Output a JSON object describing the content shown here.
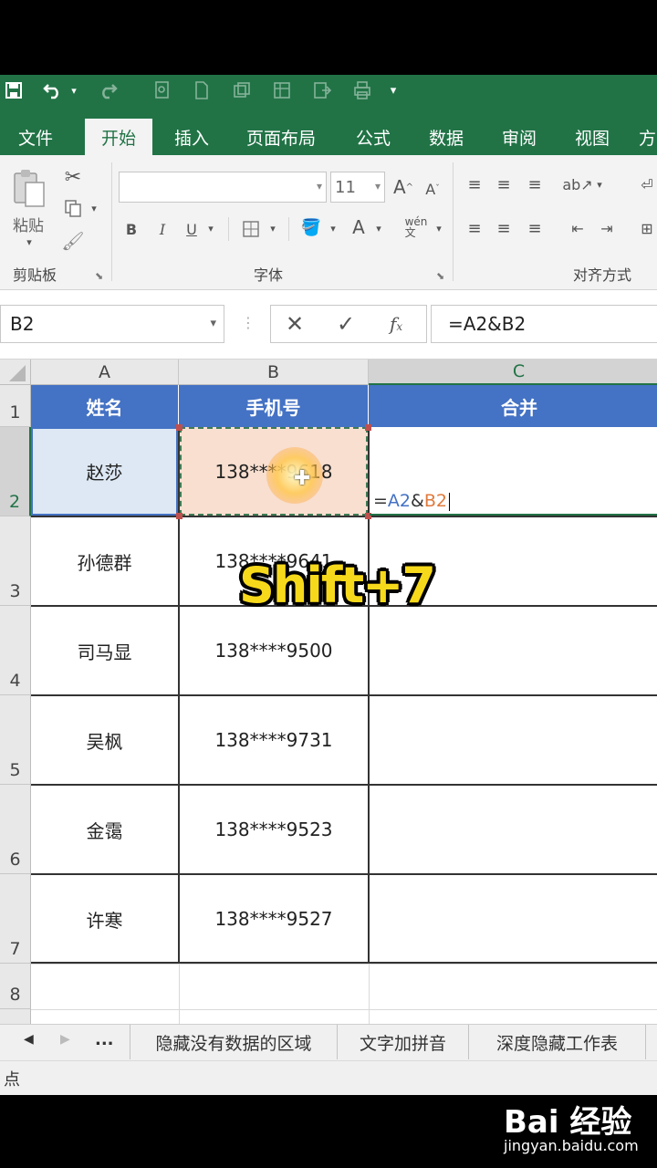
{
  "qat": {
    "save_icon": "save-icon",
    "undo_icon": "undo-icon",
    "redo_icon": "redo-icon",
    "customize_icon": "customize-qat-icon"
  },
  "tabs": [
    {
      "label": "文件"
    },
    {
      "label": "开始"
    },
    {
      "label": "插入"
    },
    {
      "label": "页面布局"
    },
    {
      "label": "公式"
    },
    {
      "label": "数据"
    },
    {
      "label": "审阅"
    },
    {
      "label": "视图"
    },
    {
      "label": "方"
    }
  ],
  "ribbon": {
    "clipboard": {
      "paste_label": "粘贴",
      "group_label": "剪贴板"
    },
    "font": {
      "font_name": "",
      "font_size": "11",
      "group_label": "字体"
    },
    "alignment": {
      "group_label": "对齐方式"
    }
  },
  "formula_bar": {
    "name_box": "B2",
    "formula": "=A2&B2"
  },
  "columns": [
    "A",
    "B",
    "C"
  ],
  "rows": [
    "1",
    "2",
    "3",
    "4",
    "5",
    "6",
    "7",
    "8"
  ],
  "table": {
    "headers": [
      "姓名",
      "手机号",
      "合并"
    ],
    "rows": [
      {
        "name": "赵莎",
        "phone": "138****9618"
      },
      {
        "name": "孙德群",
        "phone": "138****9641"
      },
      {
        "name": "司马显",
        "phone": "138****9500"
      },
      {
        "name": "吴枫",
        "phone": "138****9731"
      },
      {
        "name": "金霭",
        "phone": "138****9523"
      },
      {
        "name": "许寒",
        "phone": "138****9527"
      }
    ]
  },
  "editing_cell": {
    "eq": "=",
    "ref1": "A2",
    "amp": "&",
    "ref2": "B2"
  },
  "sheet_tabs": {
    "ellipsis": "...",
    "tabs": [
      "隐藏没有数据的区域",
      "文字加拼音",
      "深度隐藏工作表"
    ]
  },
  "status": {
    "mode": "点"
  },
  "overlay": {
    "shortcut": "Shift+7"
  },
  "watermark": {
    "logo": "Bai 经验",
    "url": "jingyan.baidu.com"
  },
  "colors": {
    "excel_green": "#217346",
    "header_blue": "#4472c4",
    "ref_blue": "#4472c4",
    "ref_orange": "#e07a3c"
  }
}
